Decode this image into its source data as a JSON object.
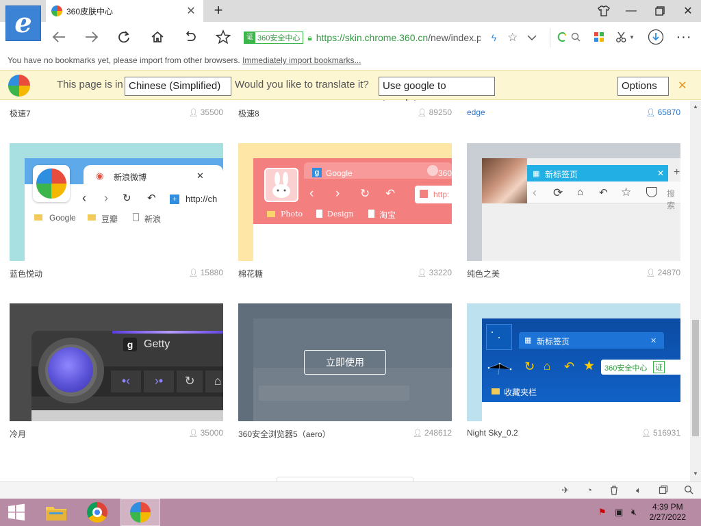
{
  "tab": {
    "title": "360皮肤中心"
  },
  "address": {
    "badge": "360安全中心",
    "badge_icon": "证",
    "url_host": "https://skin.chrome.360.cn",
    "url_path": "/new/index.p"
  },
  "bookmarks_bar": {
    "message": "You have no bookmarks yet, please import from other browsers.",
    "link": "Immediately import bookmarks..."
  },
  "translate": {
    "prefix": "This page is in",
    "language": "Chinese (Simplified)",
    "question": "Would you like to translate it?",
    "action": "Use google to translate.",
    "options": "Options"
  },
  "row0": [
    {
      "name": "极速7",
      "count": "35500"
    },
    {
      "name": "极速8",
      "count": "89250"
    },
    {
      "name": "edge",
      "count": "65870",
      "highlight": true
    }
  ],
  "row1": [
    {
      "name": "蓝色悦动",
      "count": "15880"
    },
    {
      "name": "棉花糖",
      "count": "33220"
    },
    {
      "name": "纯色之美",
      "count": "24870"
    }
  ],
  "row2": [
    {
      "name": "冷月",
      "count": "35000"
    },
    {
      "name": "360安全浏览器5（aero）",
      "count": "248612"
    },
    {
      "name": "Night Sky_0.2",
      "count": "516931"
    }
  ],
  "thumbs": {
    "blue": {
      "tab": "新浪微博",
      "url": "http://ch",
      "bm1": "Google",
      "bm2": "豆瓣",
      "bm3": "新浪"
    },
    "cotton": {
      "tab": "Google",
      "tab2": "360",
      "url": "http:",
      "bm1": "Photo",
      "bm2": "Design",
      "bm3": "淘宝"
    },
    "pure": {
      "tab": "新标签页",
      "search": "搜索"
    },
    "moon": {
      "tab": "Getty"
    },
    "aero": {
      "button": "立即使用"
    },
    "night": {
      "tab": "新标签页",
      "badge": "360安全中心",
      "badge_icon": "证",
      "bm": "收藏夹栏"
    }
  },
  "clock": {
    "time": "4:39 PM",
    "date": "2/27/2022"
  },
  "colors": {
    "accent": "#3c83d6",
    "translate_bg": "#fdf6d3",
    "taskbar": "#b88ba4",
    "secure": "#3cb54a"
  }
}
